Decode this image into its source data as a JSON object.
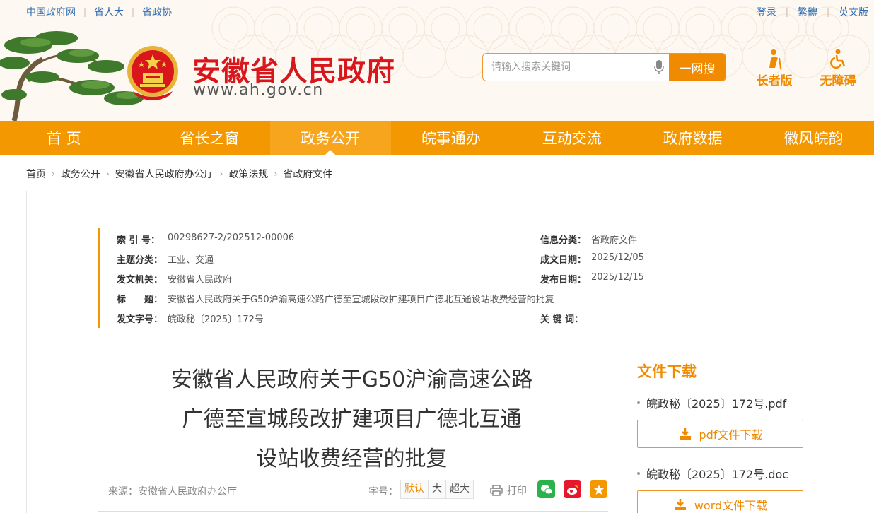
{
  "top_links": [
    "中国政府网",
    "省人大",
    "省政协"
  ],
  "user_links": [
    "登录",
    "繁體",
    "英文版"
  ],
  "site": {
    "title": "安徽省人民政府",
    "url": "www.ah.gov.cn"
  },
  "search": {
    "placeholder": "请输入搜索关键词",
    "button": "一网搜"
  },
  "modes": {
    "elder": "长者版",
    "accessible": "无障碍"
  },
  "nav": [
    "首 页",
    "省长之窗",
    "政务公开",
    "皖事通办",
    "互动交流",
    "政府数据",
    "徽风皖韵"
  ],
  "nav_active_index": 2,
  "breadcrumb": [
    "首页",
    "政务公开",
    "安徽省人民政府办公厅",
    "政策法规",
    "省政府文件"
  ],
  "meta": {
    "index_label": "索 引 号：",
    "index_value": "00298627-2/202512-00006",
    "category_label": "信息分类：",
    "category_value": "省政府文件",
    "topic_label": "主题分类：",
    "topic_value": "工业、交通",
    "created_label": "成文日期：",
    "created_value": "2025/12/05",
    "issuer_label": "发文机关：",
    "issuer_value": "安徽省人民政府",
    "published_label": "发布日期：",
    "published_value": "2025/12/15",
    "title_label": "标　　题：",
    "title_value": "安徽省人民政府关于G50沪渝高速公路广德至宣城段改扩建项目广德北互通设站收费经营的批复",
    "docno_label": "发文字号：",
    "docno_value": "皖政秘〔2025〕172号",
    "keywords_label": "关 键 词："
  },
  "document": {
    "title_lines": [
      "安徽省人民政府关于G50沪渝高速公路",
      "广德至宣城段改扩建项目广德北互通",
      "设站收费经营的批复"
    ],
    "source": "来源：安徽省人民政府办公厅",
    "font_size_label": "字号：",
    "font_sizes": [
      "默认",
      "大",
      "超大"
    ],
    "print_label": "打印"
  },
  "downloads": {
    "title": "文件下载",
    "files": [
      {
        "name": "皖政秘〔2025〕172号.pdf",
        "button": "pdf文件下载"
      },
      {
        "name": "皖政秘〔2025〕172号.doc",
        "button": "word文件下载"
      }
    ]
  },
  "colors": {
    "accent": "#f39800",
    "title_red": "#d8161b",
    "link_blue": "#2e6bb0"
  }
}
